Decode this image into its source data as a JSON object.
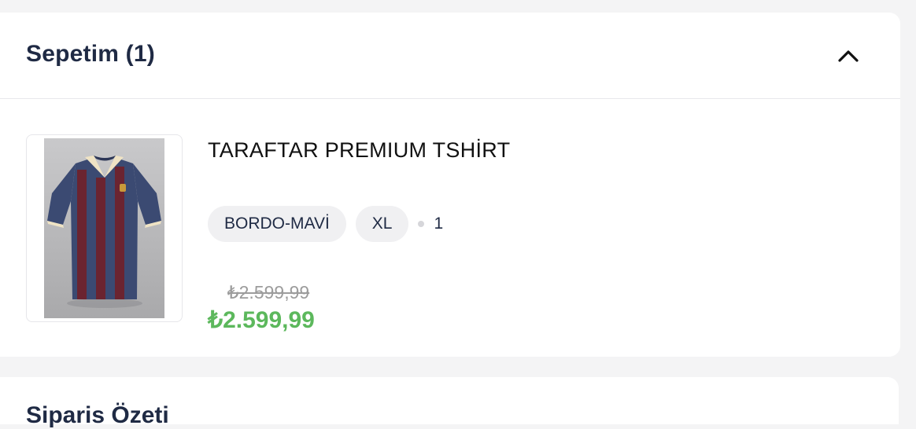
{
  "cart": {
    "title": "Sepetim (1)",
    "collapse_icon": "chevron-up-icon"
  },
  "item": {
    "name": "TARAFTAR PREMIUM TSHİRT",
    "color": "BORDO-MAVİ",
    "size": "XL",
    "quantity": "1",
    "old_price": "₺2.599,99",
    "price": "₺2.599,99",
    "image_alt": "jersey-image"
  },
  "next_section": {
    "title": "Siparis Özeti"
  },
  "colors": {
    "price_green": "#5cb85c",
    "title_navy": "#1f2a44"
  }
}
